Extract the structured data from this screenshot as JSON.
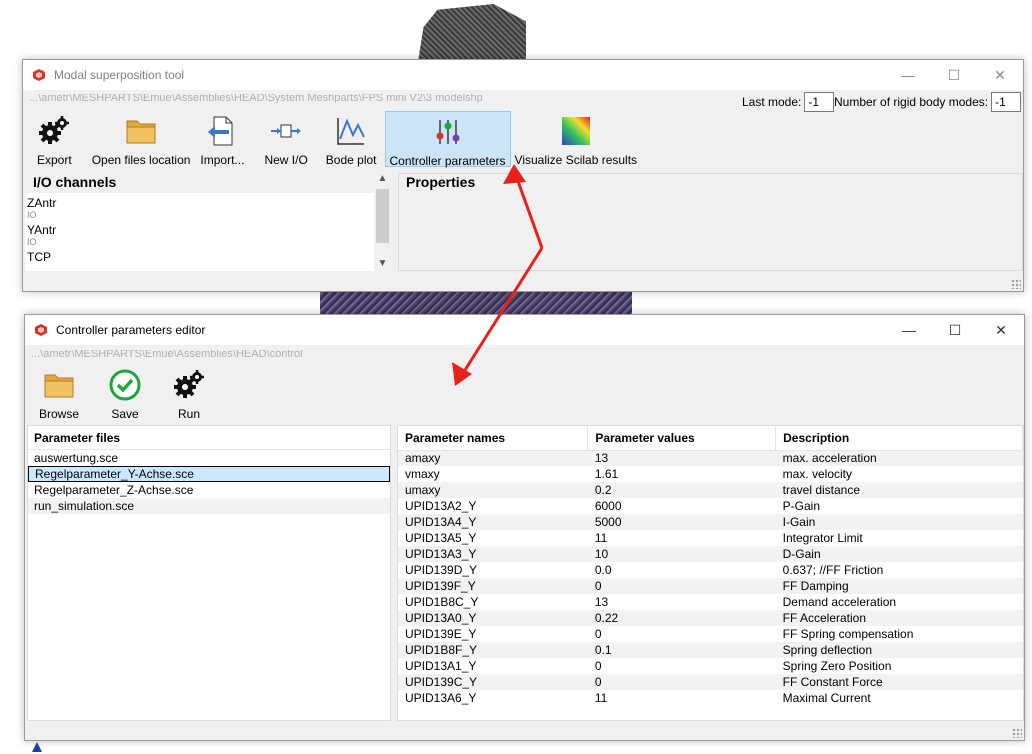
{
  "colors": {
    "accent_selection": "#cce8ff",
    "active_tool": "#cce4f7",
    "arrow": "#e8211c",
    "check_green": "#1aa83a",
    "folder": "#f3c262"
  },
  "window1": {
    "title": "Modal superposition tool",
    "path": "...\\ametr\\MESHPARTS\\Emue\\Assemblies\\HEAD\\System Meshparts\\FPS mini V2\\3 modelshp",
    "last_mode_label": "Last mode:",
    "last_mode_value": "-1",
    "rigid_modes_label": "Number of rigid body modes:",
    "rigid_modes_value": "-1",
    "toolbar": [
      {
        "label": "Export",
        "icon": "gears-icon"
      },
      {
        "label": "Open files location",
        "icon": "folder-icon"
      },
      {
        "label": "Import...",
        "icon": "import-icon"
      },
      {
        "label": "New I/O",
        "icon": "new-io-icon"
      },
      {
        "label": "Bode plot",
        "icon": "bode-plot-icon"
      },
      {
        "label": "Controller parameters",
        "icon": "sliders-icon"
      },
      {
        "label": "Visualize Scilab results",
        "icon": "gradient-icon"
      }
    ],
    "io_channels_title": "I/O channels",
    "io_channels": [
      {
        "name": "ZAntr",
        "type": "IO"
      },
      {
        "name": "YAntr",
        "type": "IO"
      },
      {
        "name": "TCP",
        "type": ""
      }
    ],
    "properties_title": "Properties"
  },
  "window2": {
    "title": "Controller parameters editor",
    "path": "...\\ametr\\MESHPARTS\\Emue\\Assemblies\\HEAD\\control",
    "toolbar": [
      {
        "label": "Browse",
        "icon": "folder-icon"
      },
      {
        "label": "Save",
        "icon": "check-icon"
      },
      {
        "label": "Run",
        "icon": "gears-icon"
      }
    ],
    "files_header": "Parameter files",
    "files": [
      "auswertung.sce",
      "Regelparameter_Y-Achse.sce",
      "Regelparameter_Z-Achse.sce",
      "run_simulation.sce"
    ],
    "selected_file_index": 1,
    "table": {
      "headers": [
        "Parameter names",
        "Parameter values",
        "Description"
      ],
      "rows": [
        [
          "amaxy",
          "13",
          "max. acceleration"
        ],
        [
          "vmaxy",
          "1.61",
          "max. velocity"
        ],
        [
          "umaxy",
          "0.2",
          "travel distance"
        ],
        [
          "UPID13A2_Y",
          "6000",
          "P-Gain"
        ],
        [
          "UPID13A4_Y",
          "5000",
          "I-Gain"
        ],
        [
          "UPID13A5_Y",
          "11",
          "Integrator Limit"
        ],
        [
          "UPID13A3_Y",
          "10",
          "D-Gain"
        ],
        [
          "UPID139D_Y",
          "0.0",
          "0.637; //FF Friction"
        ],
        [
          "UPID139F_Y",
          "0",
          "FF Damping"
        ],
        [
          "UPID1B8C_Y",
          "13",
          "Demand acceleration"
        ],
        [
          "UPID13A0_Y",
          "0.22",
          "FF Acceleration"
        ],
        [
          "UPID139E_Y",
          "0",
          "FF Spring compensation"
        ],
        [
          "UPID1B8F_Y",
          "0.1",
          "Spring deflection"
        ],
        [
          "UPID13A1_Y",
          "0",
          "Spring Zero Position"
        ],
        [
          "UPID139C_Y",
          "0",
          "FF Constant Force"
        ],
        [
          "UPID13A6_Y",
          "11",
          "Maximal Current"
        ]
      ]
    }
  }
}
